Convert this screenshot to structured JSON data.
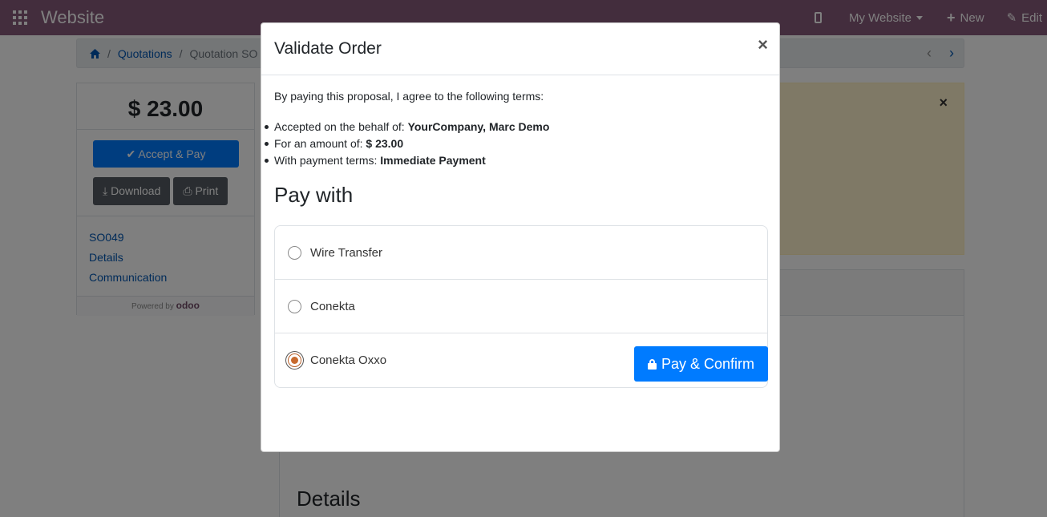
{
  "navbar": {
    "brand": "Website",
    "my_website": "My Website",
    "new_label": "New",
    "edit_label": "Edit"
  },
  "breadcrumb": {
    "items": [
      "Quotations",
      "Quotation SO"
    ]
  },
  "sidebar": {
    "amount": "$ 23.00",
    "accept_pay": "Accept & Pay",
    "download": "Download",
    "print": "Print",
    "links": [
      "SO049",
      "Details",
      "Communication"
    ],
    "powered_by": "Powered by",
    "powered_brand": "odoo"
  },
  "main": {
    "details_heading": "Details"
  },
  "modal": {
    "title": "Validate Order",
    "close": "×",
    "intro": "By paying this proposal, I agree to the following terms:",
    "terms": [
      {
        "label": "Accepted on the behalf of: ",
        "value": "YourCompany, Marc Demo"
      },
      {
        "label": "For an amount of: ",
        "value": "$ 23.00"
      },
      {
        "label": "With payment terms: ",
        "value": "Immediate Payment"
      }
    ],
    "pay_with": "Pay with",
    "methods": [
      {
        "label": "Wire Transfer",
        "selected": false
      },
      {
        "label": "Conekta",
        "selected": false
      },
      {
        "label": "Conekta Oxxo",
        "selected": true
      }
    ],
    "confirm_button": "Pay & Confirm"
  },
  "colors": {
    "navbar": "#875a7b",
    "primary": "#007bff",
    "selected_radio": "#c86a2e"
  }
}
